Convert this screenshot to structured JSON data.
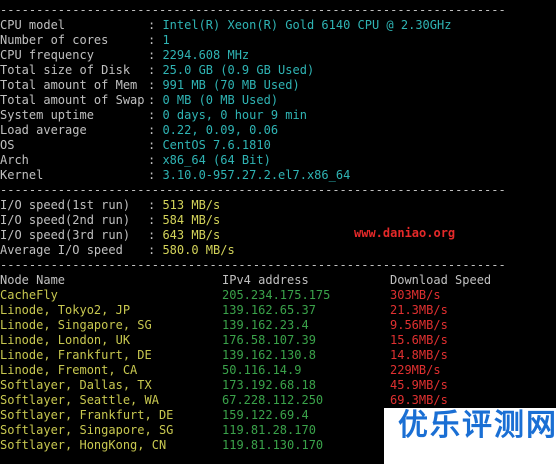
{
  "separator": "----------------------------------------------------------------------",
  "system_info": [
    {
      "label": "CPU model",
      "value": "Intel(R) Xeon(R) Gold 6140 CPU @ 2.30GHz"
    },
    {
      "label": "Number of cores",
      "value": "1"
    },
    {
      "label": "CPU frequency",
      "value": "2294.608 MHz"
    },
    {
      "label": "Total size of Disk",
      "value": "25.0 GB (0.9 GB Used)"
    },
    {
      "label": "Total amount of Mem",
      "value": "991 MB (70 MB Used)"
    },
    {
      "label": "Total amount of Swap",
      "value": "0 MB (0 MB Used)"
    },
    {
      "label": "System uptime",
      "value": "0 days, 0 hour 9 min"
    },
    {
      "label": "Load average",
      "value": "0.22, 0.09, 0.06"
    },
    {
      "label": "OS",
      "value": "CentOS 7.6.1810"
    },
    {
      "label": "Arch",
      "value": "x86_64 (64 Bit)"
    },
    {
      "label": "Kernel",
      "value": "3.10.0-957.27.2.el7.x86_64"
    }
  ],
  "io_info": [
    {
      "label": "I/O speed(1st run)",
      "value": "513 MB/s"
    },
    {
      "label": "I/O speed(2nd run)",
      "value": "584 MB/s"
    },
    {
      "label": "I/O speed(3rd run)",
      "value": "643 MB/s"
    },
    {
      "label": "Average I/O speed",
      "value": "580.0 MB/s"
    }
  ],
  "speed_table": {
    "headers": {
      "node": "Node Name",
      "ip": "IPv4 address",
      "speed": "Download Speed"
    },
    "rows": [
      {
        "node": "CacheFly",
        "ip": "205.234.175.175",
        "speed": "303MB/s"
      },
      {
        "node": "Linode, Tokyo2, JP",
        "ip": "139.162.65.37",
        "speed": "21.3MB/s"
      },
      {
        "node": "Linode, Singapore, SG",
        "ip": "139.162.23.4",
        "speed": "9.56MB/s"
      },
      {
        "node": "Linode, London, UK",
        "ip": "176.58.107.39",
        "speed": "15.6MB/s"
      },
      {
        "node": "Linode, Frankfurt, DE",
        "ip": "139.162.130.8",
        "speed": "14.8MB/s"
      },
      {
        "node": "Linode, Fremont, CA",
        "ip": "50.116.14.9",
        "speed": "229MB/s"
      },
      {
        "node": "Softlayer, Dallas, TX",
        "ip": "173.192.68.18",
        "speed": "45.9MB/s"
      },
      {
        "node": "Softlayer, Seattle, WA",
        "ip": "67.228.112.250",
        "speed": "69.3MB/s"
      },
      {
        "node": "Softlayer, Frankfurt, DE",
        "ip": "159.122.69.4",
        "speed": ""
      },
      {
        "node": "Softlayer, Singapore, SG",
        "ip": "119.81.28.170",
        "speed": ""
      },
      {
        "node": "Softlayer, HongKong, CN",
        "ip": "119.81.130.170",
        "speed": ""
      }
    ]
  },
  "watermark": {
    "url": "www.daniao.org",
    "logo": "优乐评测网"
  },
  "colors": {
    "background": "#000000",
    "label": "#c0c0c0",
    "value_cyan": "#2fb4b4",
    "value_yellow": "#d4d45a",
    "ip_green": "#3aa24a",
    "speed_red": "#e03030",
    "node_yellow": "#c8c850",
    "watermark_red": "#e52929",
    "logo_blue": "#1a6fd4"
  }
}
